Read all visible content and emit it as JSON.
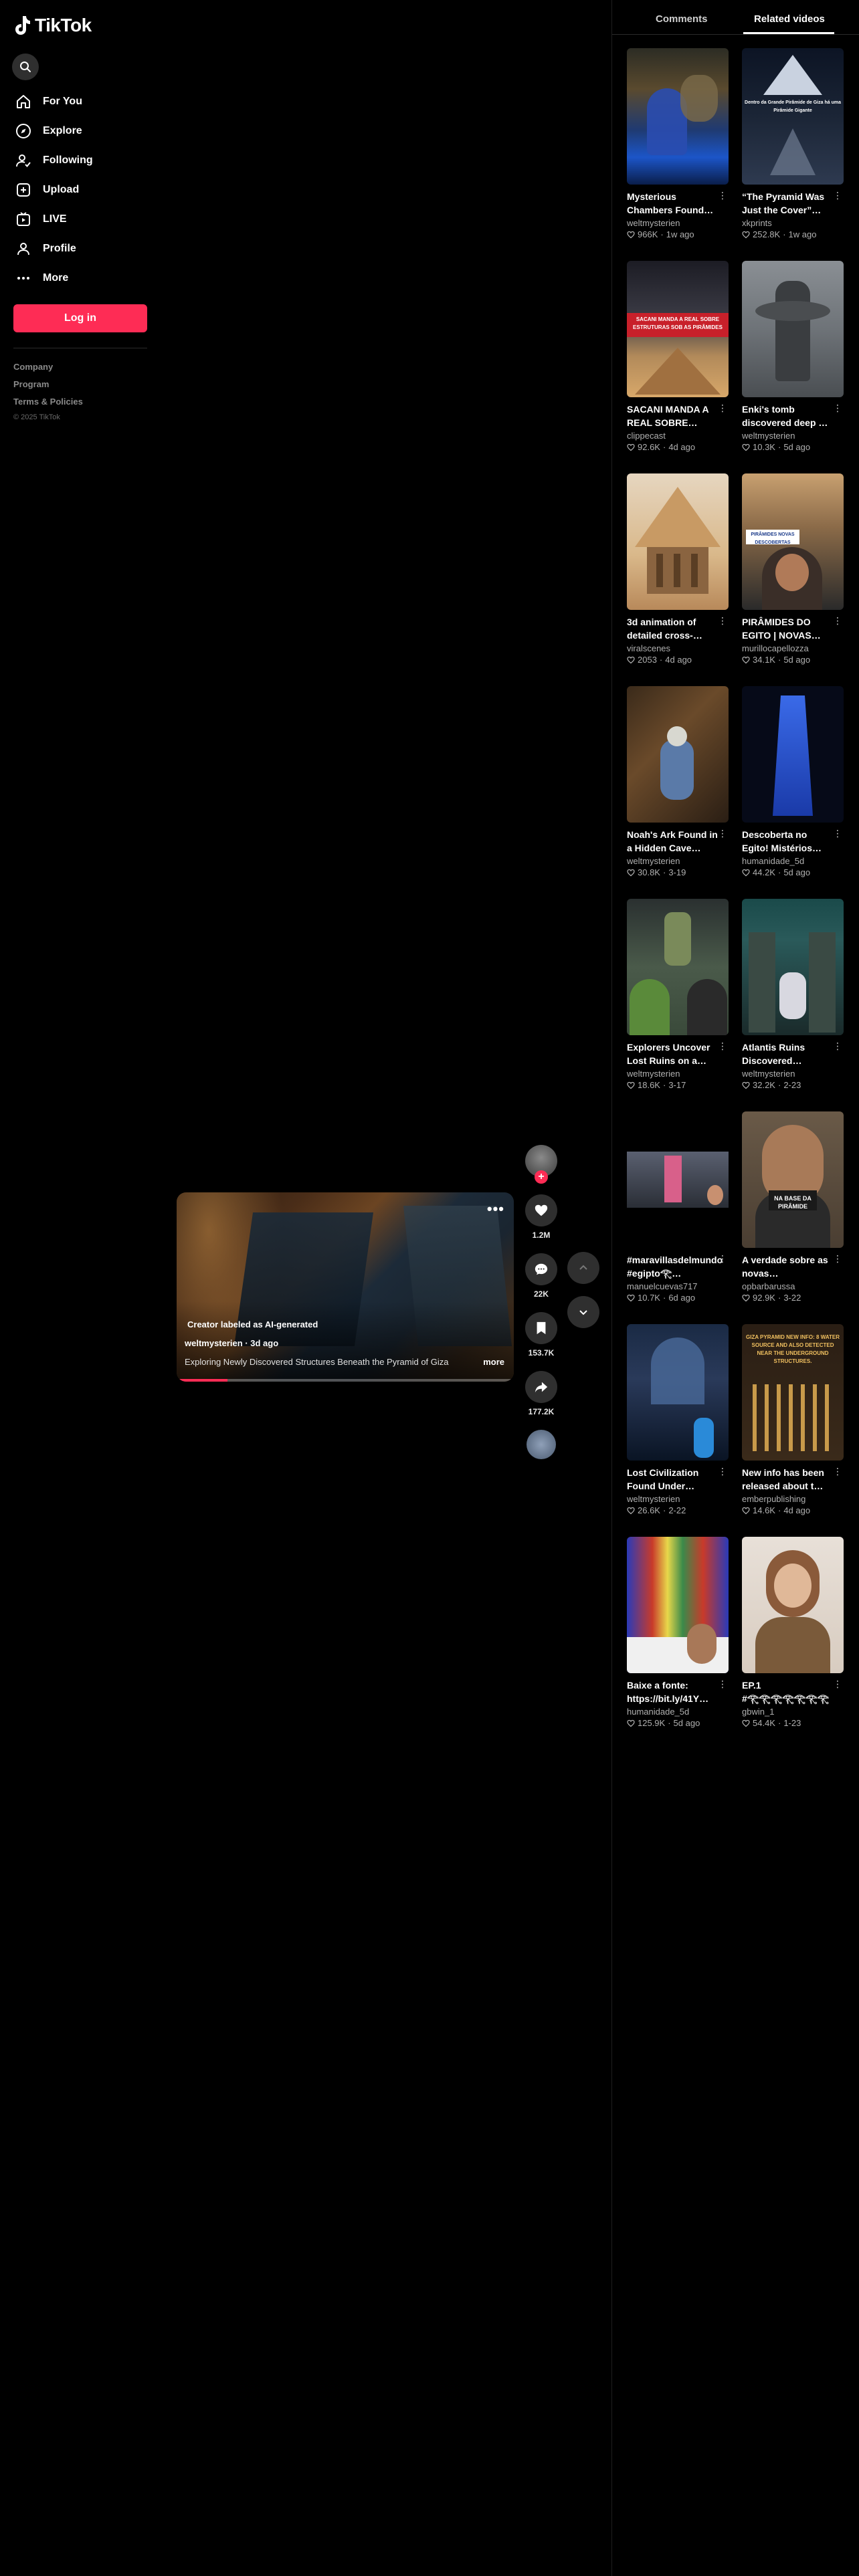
{
  "app": {
    "name": "TikTok"
  },
  "sidebar": {
    "items": [
      {
        "label": "For You",
        "icon": "home-icon"
      },
      {
        "label": "Explore",
        "icon": "compass-icon"
      },
      {
        "label": "Following",
        "icon": "following-icon"
      },
      {
        "label": "Upload",
        "icon": "upload-icon"
      },
      {
        "label": "LIVE",
        "icon": "live-icon"
      },
      {
        "label": "Profile",
        "icon": "profile-icon"
      },
      {
        "label": "More",
        "icon": "more-icon"
      }
    ],
    "login_label": "Log in",
    "footer": [
      "Company",
      "Program",
      "Terms & Policies"
    ],
    "copyright": "© 2025 TikTok"
  },
  "video": {
    "ai_label": "Creator labeled as AI-generated",
    "author": "weltmysterien",
    "age": "3d ago",
    "description": "Exploring Newly Discovered Structures Beneath the Pyramid of Giza",
    "more_label": "more",
    "progress": 0.15,
    "likes": "1.2M",
    "comments": "22K",
    "saves": "153.7K",
    "shares": "177.2K"
  },
  "right_panel": {
    "tabs": [
      "Comments",
      "Related videos"
    ],
    "active_tab": "Related videos"
  },
  "colors": {
    "accent": "#fe2c55",
    "background": "#000000",
    "muted": "#b0b0b0"
  },
  "related": [
    {
      "title": "Mysterious Chambers Found…",
      "author": "weltmysterien",
      "likes": "966K",
      "age": "1w ago"
    },
    {
      "title": "“The Pyramid Was Just the Cover”…",
      "author": "xkprints",
      "likes": "252.8K",
      "age": "1w ago"
    },
    {
      "title": "SACANI MANDA A REAL SOBRE…",
      "author": "clippecast",
      "likes": "92.6K",
      "age": "4d ago"
    },
    {
      "title": "Enki's tomb discovered deep …",
      "author": "weltmysterien",
      "likes": "10.3K",
      "age": "5d ago"
    },
    {
      "title": "3d animation of detailed cross-…",
      "author": "viralscenes",
      "likes": "2053",
      "age": "4d ago"
    },
    {
      "title": "PIRÂMIDES DO EGITO | NOVAS…",
      "author": "murillocapellozza",
      "likes": "34.1K",
      "age": "5d ago"
    },
    {
      "title": "Noah's Ark Found in a Hidden Cave…",
      "author": "weltmysterien",
      "likes": "30.8K",
      "age": "3-19"
    },
    {
      "title": "Descoberta no Egito! Mistérios…",
      "author": "humanidade_5d",
      "likes": "44.2K",
      "age": "5d ago"
    },
    {
      "title": "Explorers Uncover Lost Ruins on a…",
      "author": "weltmysterien",
      "likes": "18.6K",
      "age": "3-17"
    },
    {
      "title": "Atlantis Ruins Discovered…",
      "author": "weltmysterien",
      "likes": "32.2K",
      "age": "2-23"
    },
    {
      "title": "#maravillasdelmundo #egipto𓂀…",
      "author": "manuelcuevas717",
      "likes": "10.7K",
      "age": "6d ago"
    },
    {
      "title": "A verdade sobre as novas…",
      "author": "opbarbarussa",
      "likes": "92.9K",
      "age": "3-22"
    },
    {
      "title": "Lost Civilization Found Under…",
      "author": "weltmysterien",
      "likes": "26.6K",
      "age": "2-22"
    },
    {
      "title": "New info has been released about t…",
      "author": "emberpublishing",
      "likes": "14.6K",
      "age": "4d ago"
    },
    {
      "title": "Baixe a fonte: https://bit.ly/41Y…",
      "author": "humanidade_5d",
      "likes": "125.9K",
      "age": "5d ago"
    },
    {
      "title": "EP.1 #𓂀𓂀𓂀𓂀𓂀𓂀𓂀 #𓂀𓂀𓂀𓂀𓂀𓂀𓂀 #…",
      "author": "gbwin_1",
      "likes": "54.4K",
      "age": "1-23"
    }
  ],
  "thumb_captions": {
    "pyramid_text": "Dentro da Grande Pirâmide de Giza há uma Pirâmide Gigante",
    "sacani_text": "SACANI MANDA A REAL SOBRE ESTRUTURAS SOB AS PIRÂMIDES",
    "piramides_text": "PIRÂMIDES NOVAS DESCOBERTAS",
    "base_text": "NA BASE DA PIRÂMIDE",
    "giza_text": "GIZA PYRAMID NEW INFO: 8 WATER SOURCE AND ALSO DETECTED NEAR THE UNDERGROUND STRUCTURES."
  }
}
